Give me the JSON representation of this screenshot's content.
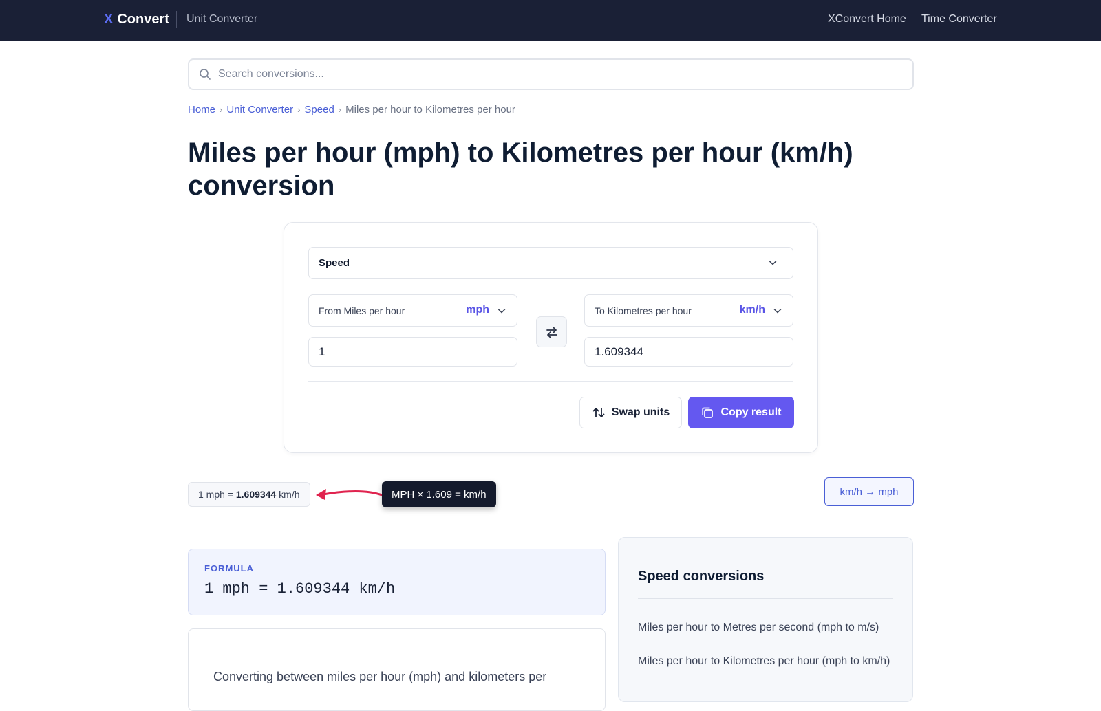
{
  "header": {
    "brand_x": "X",
    "brand_name": "Convert",
    "brand_sub": "Unit Converter",
    "nav": [
      "XConvert Home",
      "Time Converter"
    ]
  },
  "search": {
    "placeholder": "Search conversions..."
  },
  "breadcrumb": [
    "Home",
    "Unit Converter",
    "Speed",
    "Miles per hour to Kilometres per hour"
  ],
  "page_title": "Miles per hour (mph) to Kilometres per hour (km/h) conversion",
  "converter": {
    "category": "Speed",
    "from_label": "From Miles per hour",
    "from_abbr": "mph",
    "from_value": "1",
    "to_label": "To Kilometres per hour",
    "to_abbr": "km/h",
    "to_value": "1.609344",
    "swap_label": "Swap units",
    "copy_label": "Copy result"
  },
  "result_badge": {
    "prefix": "1 mph = ",
    "value": "1.609344",
    "suffix": " km/h"
  },
  "tooltip": "MPH × 1.609 = km/h",
  "reverse_link": "km/h → mph",
  "formula": {
    "label": "FORMULA",
    "code": "1 mph = 1.609344 km/h"
  },
  "sidebar": {
    "title": "Speed conversions",
    "links": [
      "Miles per hour to Metres per second (mph to m/s)",
      "Miles per hour to Kilometres per hour (mph to km/h)"
    ]
  },
  "description": "Converting between miles per hour (mph) and kilometers per",
  "colors": {
    "accent": "#6458f0",
    "link": "#4a5fd6",
    "topbar": "#1a2036",
    "tooltip_arrow": "#e0244f"
  }
}
